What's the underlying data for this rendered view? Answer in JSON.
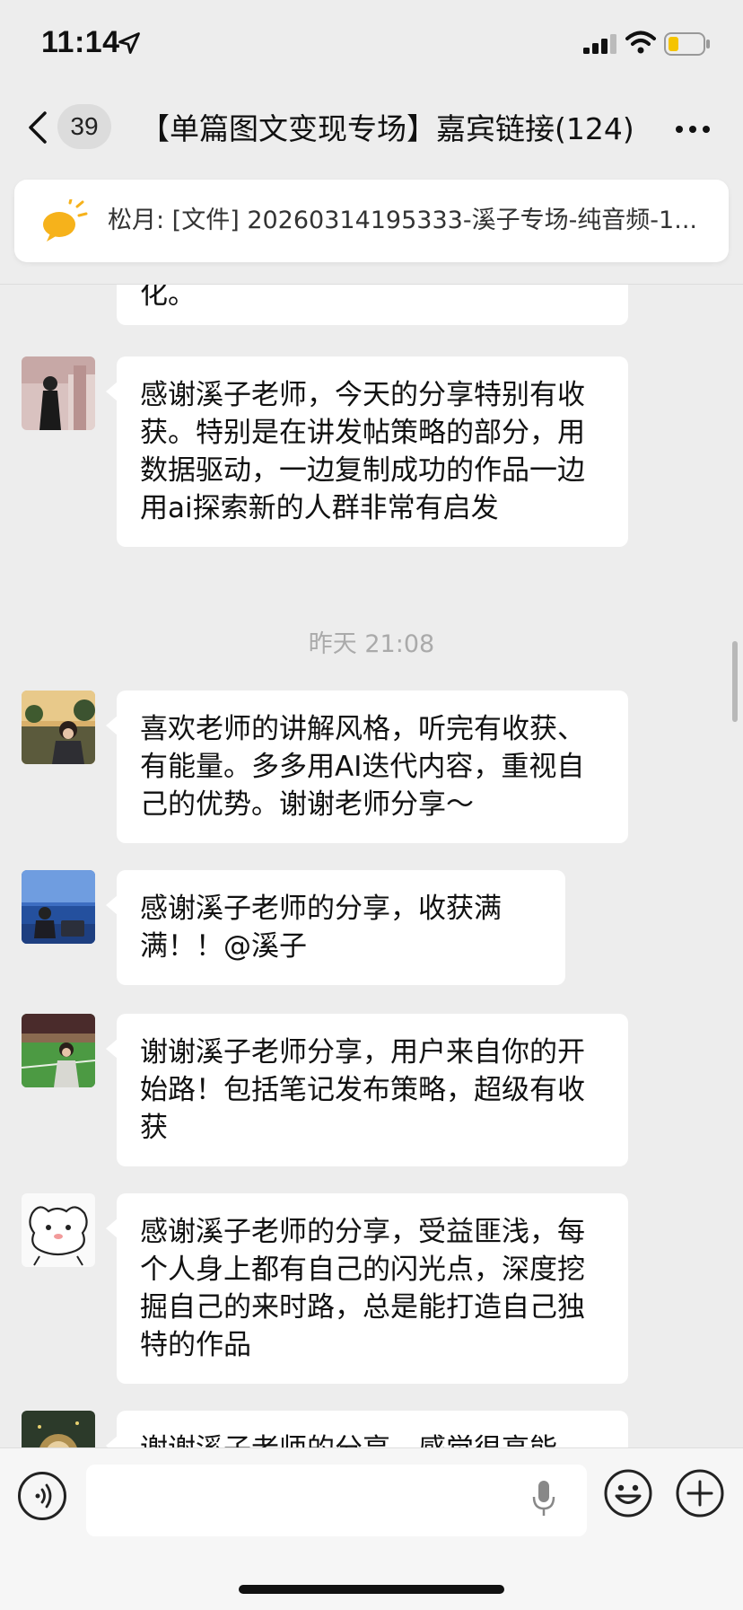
{
  "status_bar": {
    "time": "11:14"
  },
  "nav": {
    "unread_count": "39",
    "title": "【单篇图文变现专场】嘉宾链接(124)"
  },
  "pinned": {
    "text": "松月: [文件] 20260314195333-溪子专场-纯音频-1..."
  },
  "messages": [
    {
      "text": "化。"
    },
    {
      "text": "感谢溪子老师，今天的分享特别有收获。特别是在讲发帖策略的部分，用数据驱动，一边复制成功的作品一边用ai探索新的人群非常有启发"
    },
    {
      "text": "喜欢老师的讲解风格，听完有收获、有能量。多多用AI迭代内容，重视自己的优势。谢谢老师分享～"
    },
    {
      "text": "感谢溪子老师的分享，收获满满！！@溪子"
    },
    {
      "text": "谢谢溪子老师分享，用户来自你的开始路！包括笔记发布策略，超级有收获"
    },
    {
      "text": "感谢溪子老师的分享，受益匪浅，每个人身上都有自己的闪光点，深度挖掘自己的来时路，总是能打造自己独特的作品"
    },
    {
      "text": "谢谢溪子老师的分享，感觉很高能"
    }
  ],
  "timestamp": "昨天 21:08",
  "colors": {
    "bg": "#ededed",
    "bubble": "#ffffff",
    "timestamp": "#aaaaaa",
    "bulb": "#f6b21b"
  }
}
